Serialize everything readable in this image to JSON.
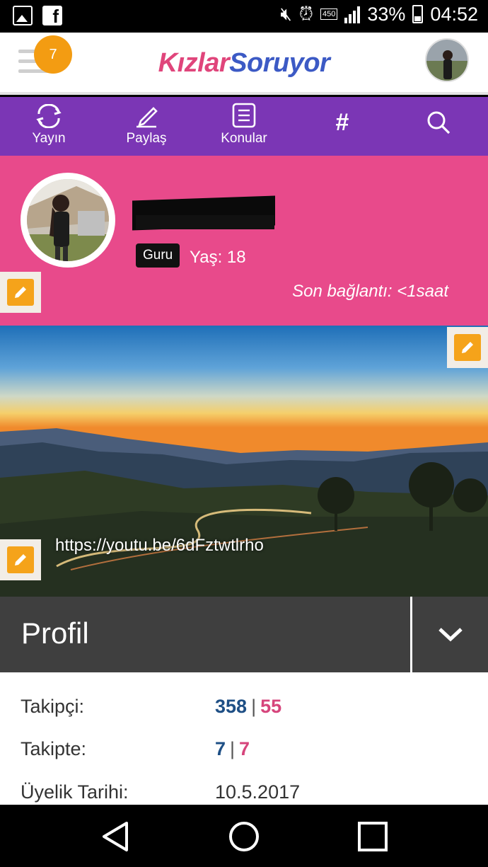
{
  "status_bar": {
    "battery": "33%",
    "time": "04:52",
    "data_badge": "450",
    "icons": [
      "gallery-icon",
      "facebook-icon",
      "mute-icon",
      "alarm-icon",
      "data-icon",
      "signal-icon",
      "battery-icon"
    ]
  },
  "header": {
    "notification_count": "7",
    "logo_part1": "Kızlar",
    "logo_part2": "Soruyor"
  },
  "nav": {
    "items": [
      {
        "label": "Yayın",
        "icon": "feed-icon"
      },
      {
        "label": "Paylaş",
        "icon": "pencil-icon"
      },
      {
        "label": "Konular",
        "icon": "list-icon"
      },
      {
        "label": "",
        "icon": "hashtag-icon"
      },
      {
        "label": "",
        "icon": "search-icon"
      }
    ]
  },
  "profile": {
    "badge": "Guru",
    "age": "Yaş: 18",
    "last_seen": "Son bağlantı: <1saat"
  },
  "cover": {
    "link": "https://youtu.be/6dFztwtlrho"
  },
  "section": {
    "title": "Profil"
  },
  "stats": {
    "followers_label": "Takipçi:",
    "followers_a": "358",
    "followers_b": "55",
    "following_label": "Takipte:",
    "following_a": "7",
    "following_b": "7",
    "member_label": "Üyelik Tarihi:",
    "member_since": "10.5.2017",
    "separator": "|"
  },
  "colors": {
    "purple_nav": "#7b36b5",
    "pink_banner": "#e84a8b",
    "accent_orange": "#f39c12",
    "blue_stat": "#1e4f85",
    "pink_stat": "#d6457c"
  }
}
